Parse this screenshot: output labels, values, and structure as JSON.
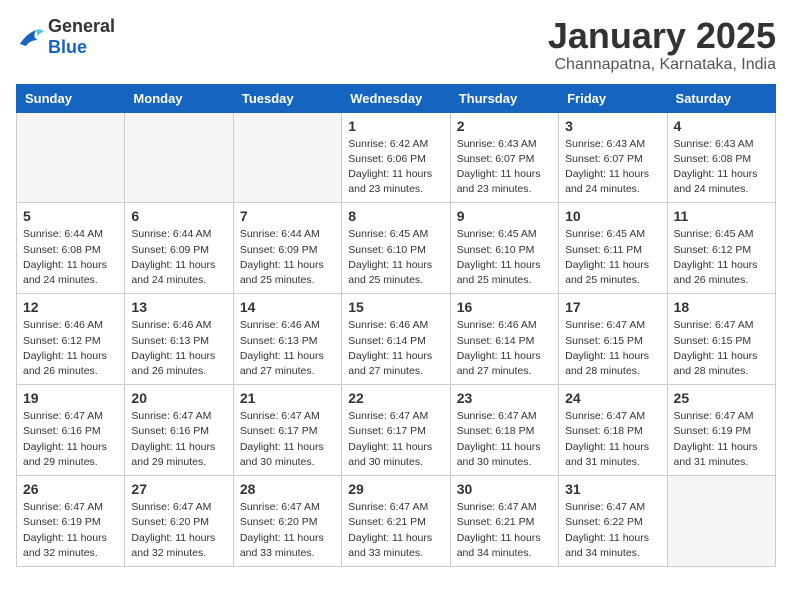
{
  "header": {
    "logo": {
      "general": "General",
      "blue": "Blue"
    },
    "title": "January 2025",
    "location": "Channapatna, Karnataka, India"
  },
  "calendar": {
    "weekdays": [
      "Sunday",
      "Monday",
      "Tuesday",
      "Wednesday",
      "Thursday",
      "Friday",
      "Saturday"
    ],
    "weeks": [
      [
        {
          "day": null,
          "sunrise": null,
          "sunset": null,
          "daylight": null
        },
        {
          "day": null,
          "sunrise": null,
          "sunset": null,
          "daylight": null
        },
        {
          "day": null,
          "sunrise": null,
          "sunset": null,
          "daylight": null
        },
        {
          "day": 1,
          "sunrise": "6:42 AM",
          "sunset": "6:06 PM",
          "daylight": "11 hours and 23 minutes."
        },
        {
          "day": 2,
          "sunrise": "6:43 AM",
          "sunset": "6:07 PM",
          "daylight": "11 hours and 23 minutes."
        },
        {
          "day": 3,
          "sunrise": "6:43 AM",
          "sunset": "6:07 PM",
          "daylight": "11 hours and 24 minutes."
        },
        {
          "day": 4,
          "sunrise": "6:43 AM",
          "sunset": "6:08 PM",
          "daylight": "11 hours and 24 minutes."
        }
      ],
      [
        {
          "day": 5,
          "sunrise": "6:44 AM",
          "sunset": "6:08 PM",
          "daylight": "11 hours and 24 minutes."
        },
        {
          "day": 6,
          "sunrise": "6:44 AM",
          "sunset": "6:09 PM",
          "daylight": "11 hours and 24 minutes."
        },
        {
          "day": 7,
          "sunrise": "6:44 AM",
          "sunset": "6:09 PM",
          "daylight": "11 hours and 25 minutes."
        },
        {
          "day": 8,
          "sunrise": "6:45 AM",
          "sunset": "6:10 PM",
          "daylight": "11 hours and 25 minutes."
        },
        {
          "day": 9,
          "sunrise": "6:45 AM",
          "sunset": "6:10 PM",
          "daylight": "11 hours and 25 minutes."
        },
        {
          "day": 10,
          "sunrise": "6:45 AM",
          "sunset": "6:11 PM",
          "daylight": "11 hours and 25 minutes."
        },
        {
          "day": 11,
          "sunrise": "6:45 AM",
          "sunset": "6:12 PM",
          "daylight": "11 hours and 26 minutes."
        }
      ],
      [
        {
          "day": 12,
          "sunrise": "6:46 AM",
          "sunset": "6:12 PM",
          "daylight": "11 hours and 26 minutes."
        },
        {
          "day": 13,
          "sunrise": "6:46 AM",
          "sunset": "6:13 PM",
          "daylight": "11 hours and 26 minutes."
        },
        {
          "day": 14,
          "sunrise": "6:46 AM",
          "sunset": "6:13 PM",
          "daylight": "11 hours and 27 minutes."
        },
        {
          "day": 15,
          "sunrise": "6:46 AM",
          "sunset": "6:14 PM",
          "daylight": "11 hours and 27 minutes."
        },
        {
          "day": 16,
          "sunrise": "6:46 AM",
          "sunset": "6:14 PM",
          "daylight": "11 hours and 27 minutes."
        },
        {
          "day": 17,
          "sunrise": "6:47 AM",
          "sunset": "6:15 PM",
          "daylight": "11 hours and 28 minutes."
        },
        {
          "day": 18,
          "sunrise": "6:47 AM",
          "sunset": "6:15 PM",
          "daylight": "11 hours and 28 minutes."
        }
      ],
      [
        {
          "day": 19,
          "sunrise": "6:47 AM",
          "sunset": "6:16 PM",
          "daylight": "11 hours and 29 minutes."
        },
        {
          "day": 20,
          "sunrise": "6:47 AM",
          "sunset": "6:16 PM",
          "daylight": "11 hours and 29 minutes."
        },
        {
          "day": 21,
          "sunrise": "6:47 AM",
          "sunset": "6:17 PM",
          "daylight": "11 hours and 30 minutes."
        },
        {
          "day": 22,
          "sunrise": "6:47 AM",
          "sunset": "6:17 PM",
          "daylight": "11 hours and 30 minutes."
        },
        {
          "day": 23,
          "sunrise": "6:47 AM",
          "sunset": "6:18 PM",
          "daylight": "11 hours and 30 minutes."
        },
        {
          "day": 24,
          "sunrise": "6:47 AM",
          "sunset": "6:18 PM",
          "daylight": "11 hours and 31 minutes."
        },
        {
          "day": 25,
          "sunrise": "6:47 AM",
          "sunset": "6:19 PM",
          "daylight": "11 hours and 31 minutes."
        }
      ],
      [
        {
          "day": 26,
          "sunrise": "6:47 AM",
          "sunset": "6:19 PM",
          "daylight": "11 hours and 32 minutes."
        },
        {
          "day": 27,
          "sunrise": "6:47 AM",
          "sunset": "6:20 PM",
          "daylight": "11 hours and 32 minutes."
        },
        {
          "day": 28,
          "sunrise": "6:47 AM",
          "sunset": "6:20 PM",
          "daylight": "11 hours and 33 minutes."
        },
        {
          "day": 29,
          "sunrise": "6:47 AM",
          "sunset": "6:21 PM",
          "daylight": "11 hours and 33 minutes."
        },
        {
          "day": 30,
          "sunrise": "6:47 AM",
          "sunset": "6:21 PM",
          "daylight": "11 hours and 34 minutes."
        },
        {
          "day": 31,
          "sunrise": "6:47 AM",
          "sunset": "6:22 PM",
          "daylight": "11 hours and 34 minutes."
        },
        {
          "day": null,
          "sunrise": null,
          "sunset": null,
          "daylight": null
        }
      ]
    ]
  }
}
